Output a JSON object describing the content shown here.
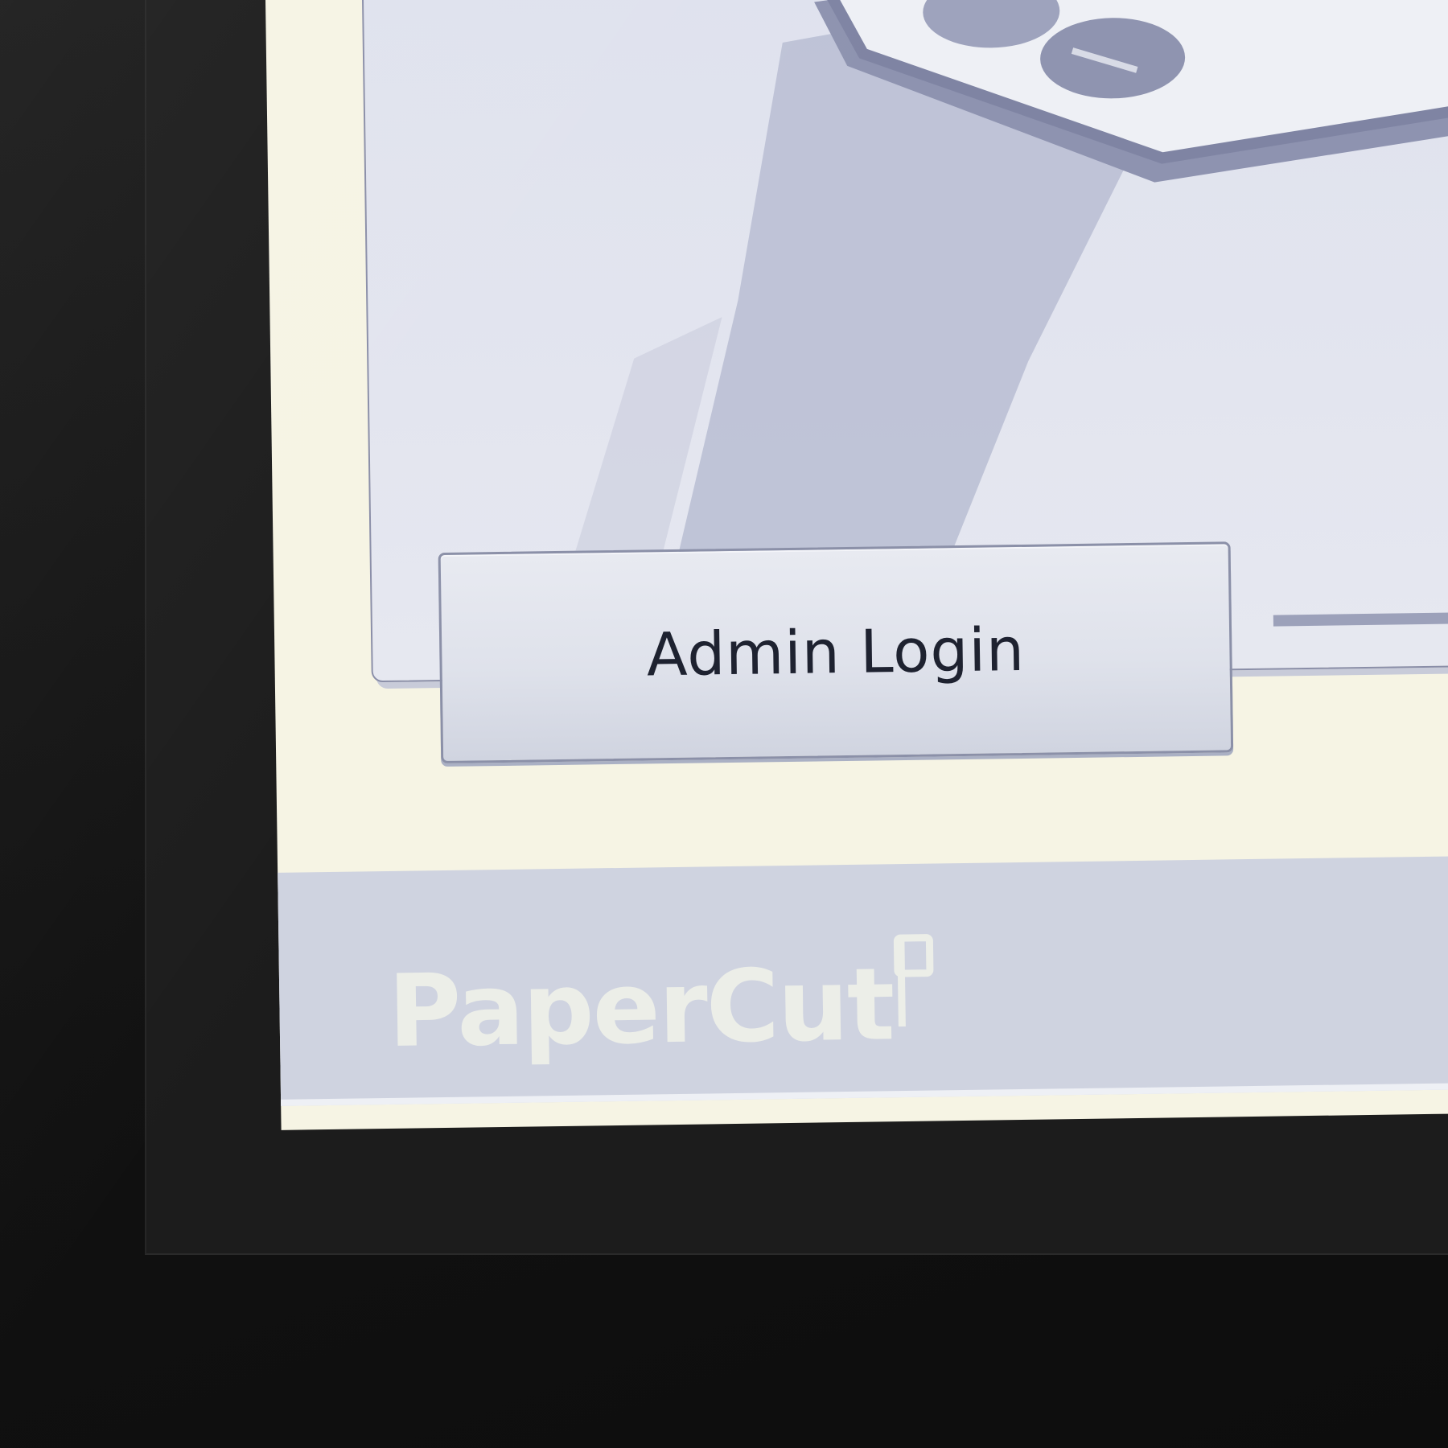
{
  "screen": {
    "button": {
      "label": "Admin Login"
    },
    "brand": {
      "name": "PaperCut"
    }
  },
  "icons": {
    "illustration": "card-reader-illustration-icon",
    "brand_mark": "papercut-logo-mark-icon"
  },
  "colors": {
    "screen_background": "#f6f4e4",
    "panel_background": "#dfe2ee",
    "button_background": "#dfe2eb",
    "button_border": "#8b90a8",
    "footer_band": "#cfd3e0",
    "brand_text": "#eceee8",
    "bezel": "#141414"
  }
}
